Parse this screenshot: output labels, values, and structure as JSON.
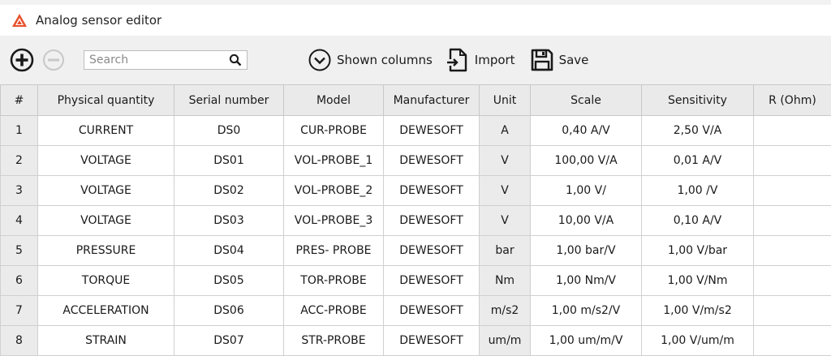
{
  "window": {
    "title": "Analog sensor editor"
  },
  "toolbar": {
    "search_placeholder": "Search",
    "shown_columns_label": "Shown columns",
    "import_label": "Import",
    "save_label": "Save"
  },
  "table": {
    "headers": [
      "#",
      "Physical quantity",
      "Serial number",
      "Model",
      "Manufacturer",
      "Unit",
      "Scale",
      "Sensitivity",
      "R (Ohm)"
    ],
    "rows": [
      [
        "1",
        "CURRENT",
        "DS0",
        "CUR-PROBE",
        "DEWESOFT",
        "A",
        "0,40 A/V",
        "2,50 V/A",
        ""
      ],
      [
        "2",
        "VOLTAGE",
        "DS01",
        "VOL-PROBE_1",
        "DEWESOFT",
        "V",
        "100,00 V/A",
        "0,01 A/V",
        ""
      ],
      [
        "3",
        "VOLTAGE",
        "DS02",
        "VOL-PROBE_2",
        "DEWESOFT",
        "V",
        "1,00 V/",
        "1,00 /V",
        ""
      ],
      [
        "4",
        "VOLTAGE",
        "DS03",
        "VOL-PROBE_3",
        "DEWESOFT",
        "V",
        "10,00 V/A",
        "0,10 A/V",
        ""
      ],
      [
        "5",
        "PRESSURE",
        "DS04",
        "PRES- PROBE",
        "DEWESOFT",
        "bar",
        "1,00 bar/V",
        "1,00 V/bar",
        ""
      ],
      [
        "6",
        "TORQUE",
        "DS05",
        "TOR-PROBE",
        "DEWESOFT",
        "Nm",
        "1,00 Nm/V",
        "1,00 V/Nm",
        ""
      ],
      [
        "7",
        "ACCELERATION",
        "DS06",
        "ACC-PROBE",
        "DEWESOFT",
        "m/s2",
        "1,00 m/s2/V",
        "1,00 V/m/s2",
        ""
      ],
      [
        "8",
        "STRAIN",
        "DS07",
        "STR-PROBE",
        "DEWESOFT",
        "um/m",
        "1,00 um/m/V",
        "1,00 V/um/m",
        ""
      ]
    ]
  },
  "icons": {
    "app": "dewesoft-logo",
    "add": "plus-circle-icon",
    "remove": "minus-circle-icon",
    "search": "magnifier-icon",
    "shown_columns": "chevron-down-circle-icon",
    "import": "import-icon",
    "save": "floppy-disk-icon"
  },
  "colors": {
    "logo_accent": "#e8502a",
    "disabled_icon": "#c8c8c8"
  }
}
